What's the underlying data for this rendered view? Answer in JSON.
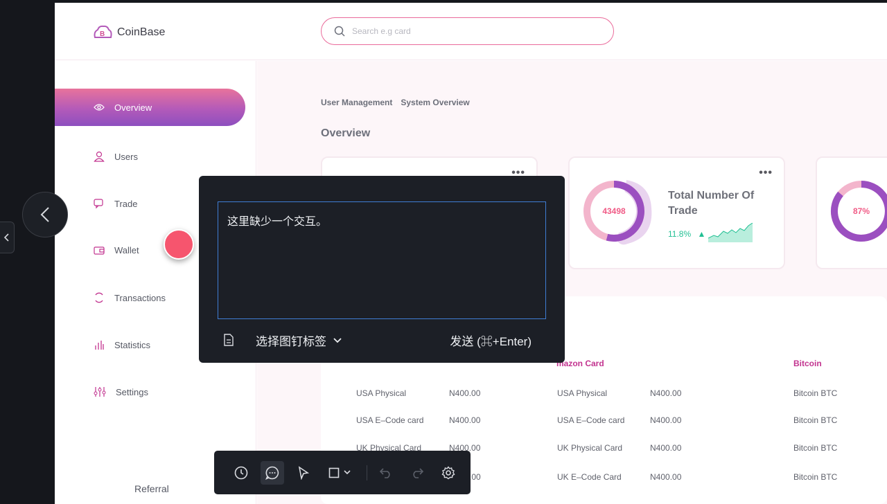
{
  "app": {
    "name": "CoinBase"
  },
  "search": {
    "placeholder": "Search e.g card"
  },
  "sidebar": {
    "items": [
      {
        "label": "Overview",
        "icon": "eye-icon",
        "active": true
      },
      {
        "label": "Users",
        "icon": "user-icon"
      },
      {
        "label": "Trade",
        "icon": "chat-icon"
      },
      {
        "label": "Wallet",
        "icon": "wallet-icon"
      },
      {
        "label": "Transactions",
        "icon": "cycle-icon"
      },
      {
        "label": "Statistics",
        "icon": "bar-chart-icon"
      },
      {
        "label": "Settings",
        "icon": "sliders-icon"
      }
    ],
    "referral": "Referral"
  },
  "breadcrumb": [
    "User Management",
    "System Overview"
  ],
  "page_title": "Overview",
  "cards": [
    {
      "value": "43498",
      "title": "Total Number Of Trade",
      "change": "11.8%",
      "trend": "up"
    },
    {
      "value": "87%"
    }
  ],
  "table": {
    "headers": [
      "mazon Card",
      "Bitcoin"
    ],
    "rows": [
      [
        "USA Physical",
        "N400.00",
        "USA Physical",
        "N400.00",
        "Bitcoin BTC"
      ],
      [
        "USA E–Code card",
        "N400.00",
        "USA E–Code card",
        "N400.00",
        "Bitcoin BTC"
      ],
      [
        "UK Physical Card",
        "N400.00",
        "UK Physical Card",
        "N400.00",
        "Bitcoin BTC"
      ],
      [
        "",
        ".00",
        "UK E–Code Card",
        "N400.00",
        "Bitcoin BTC"
      ]
    ]
  },
  "comment_popup": {
    "text": "这里缺少一个交互。",
    "pin_tag_label": "选择图钉标签",
    "send_label": "发送 (⌘+Enter)"
  },
  "colors": {
    "accent": "#ea6a9a",
    "brand_purple": "#b35ab9",
    "positive": "#21bf93",
    "popup_bg": "#1c1f26",
    "focus_border": "#3f7ed6",
    "marker": "#f6556e"
  }
}
